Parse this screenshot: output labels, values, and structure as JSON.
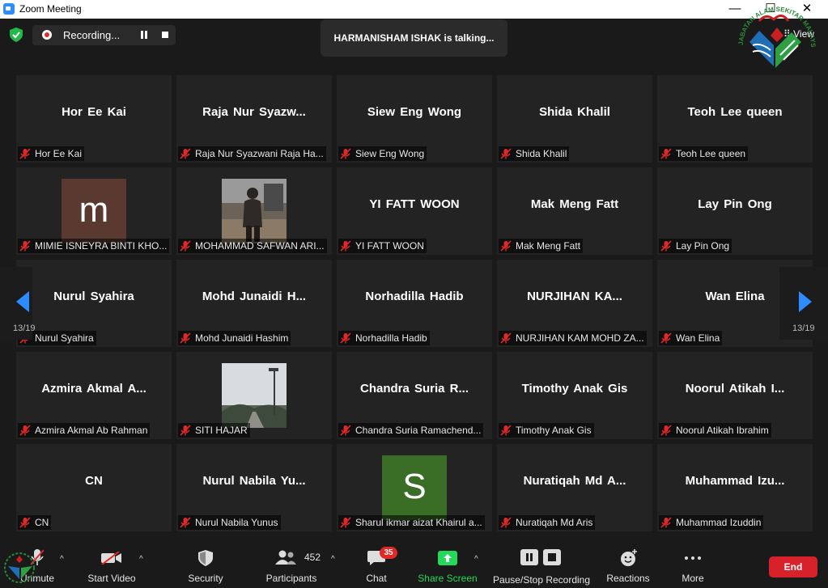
{
  "window": {
    "title": "Zoom Meeting",
    "minimize": "—",
    "maximize": "☐",
    "close": "✕"
  },
  "recording": {
    "label": "Recording..."
  },
  "talking_banner": "HARMANISHAM ISHAK is talking...",
  "view_button": "View",
  "pager": {
    "left_count": "13/19",
    "right_count": "13/19"
  },
  "tiles": [
    {
      "display": "Hor Ee Kai",
      "tag": "Hor Ee Kai"
    },
    {
      "display": "Raja Nur Syazw...",
      "tag": "Raja Nur Syazwani Raja Ha..."
    },
    {
      "display": "Siew Eng Wong",
      "tag": "Siew Eng Wong"
    },
    {
      "display": "Shida Khalil",
      "tag": "Shida Khalil"
    },
    {
      "display": "Teoh Lee queen",
      "tag": "Teoh Lee queen"
    },
    {
      "display": "",
      "avatar": "m",
      "avatar_color": "#5a3a30",
      "tag": "MIMIE ISNEYRA BINTI KHO..."
    },
    {
      "display": "",
      "photo": "person",
      "tag": "MOHAMMAD SAFWAN ARI..."
    },
    {
      "display": "YI FATT WOON",
      "tag": "YI FATT WOON"
    },
    {
      "display": "Mak Meng Fatt",
      "tag": "Mak Meng Fatt"
    },
    {
      "display": "Lay Pin Ong",
      "tag": "Lay Pin Ong"
    },
    {
      "display": "Nurul Syahira",
      "tag": "Nurul Syahira"
    },
    {
      "display": "Mohd Junaidi H...",
      "tag": "Mohd Junaidi Hashim"
    },
    {
      "display": "Norhadilla Hadib",
      "tag": "Norhadilla Hadib"
    },
    {
      "display": "NURJIHAN KA...",
      "tag": "NURJIHAN KAM MOHD ZA..."
    },
    {
      "display": "Wan Elina",
      "tag": "Wan Elina"
    },
    {
      "display": "Azmira Akmal A...",
      "tag": "Azmira Akmal Ab Rahman"
    },
    {
      "display": "",
      "photo": "lamp",
      "tag": "SITI HAJAR"
    },
    {
      "display": "Chandra Suria R...",
      "tag": "Chandra Suria Ramachend..."
    },
    {
      "display": "Timothy Anak Gis",
      "tag": "Timothy Anak Gis"
    },
    {
      "display": "Noorul Atikah I...",
      "tag": "Noorul Atikah Ibrahim"
    },
    {
      "display": "CN",
      "tag": "CN"
    },
    {
      "display": "Nurul Nabila Yu...",
      "tag": "Nurul Nabila Yunus"
    },
    {
      "display": "",
      "avatar": "S",
      "avatar_color": "#3a6e26",
      "tag": "Sharul ikmar aizat Khairul a..."
    },
    {
      "display": "Nuratiqah Md A...",
      "tag": "Nuratiqah Md Aris"
    },
    {
      "display": "Muhammad Izu...",
      "tag": "Muhammad Izuddin"
    }
  ],
  "toolbar": {
    "unmute": "Unmute",
    "start_video": "Start Video",
    "security": "Security",
    "participants": "Participants",
    "participants_count": "452",
    "chat": "Chat",
    "chat_badge": "35",
    "share_screen": "Share Screen",
    "pause_stop_recording": "Pause/Stop Recording",
    "reactions": "Reactions",
    "more": "More",
    "end": "End"
  },
  "colors": {
    "accent": "#2D8CFF",
    "share_green": "#23d959",
    "end_red": "#d8222b",
    "mute_red": "#e02828"
  },
  "logo_text": "JABATAN ALAM SEKITAR MALAYSIA"
}
